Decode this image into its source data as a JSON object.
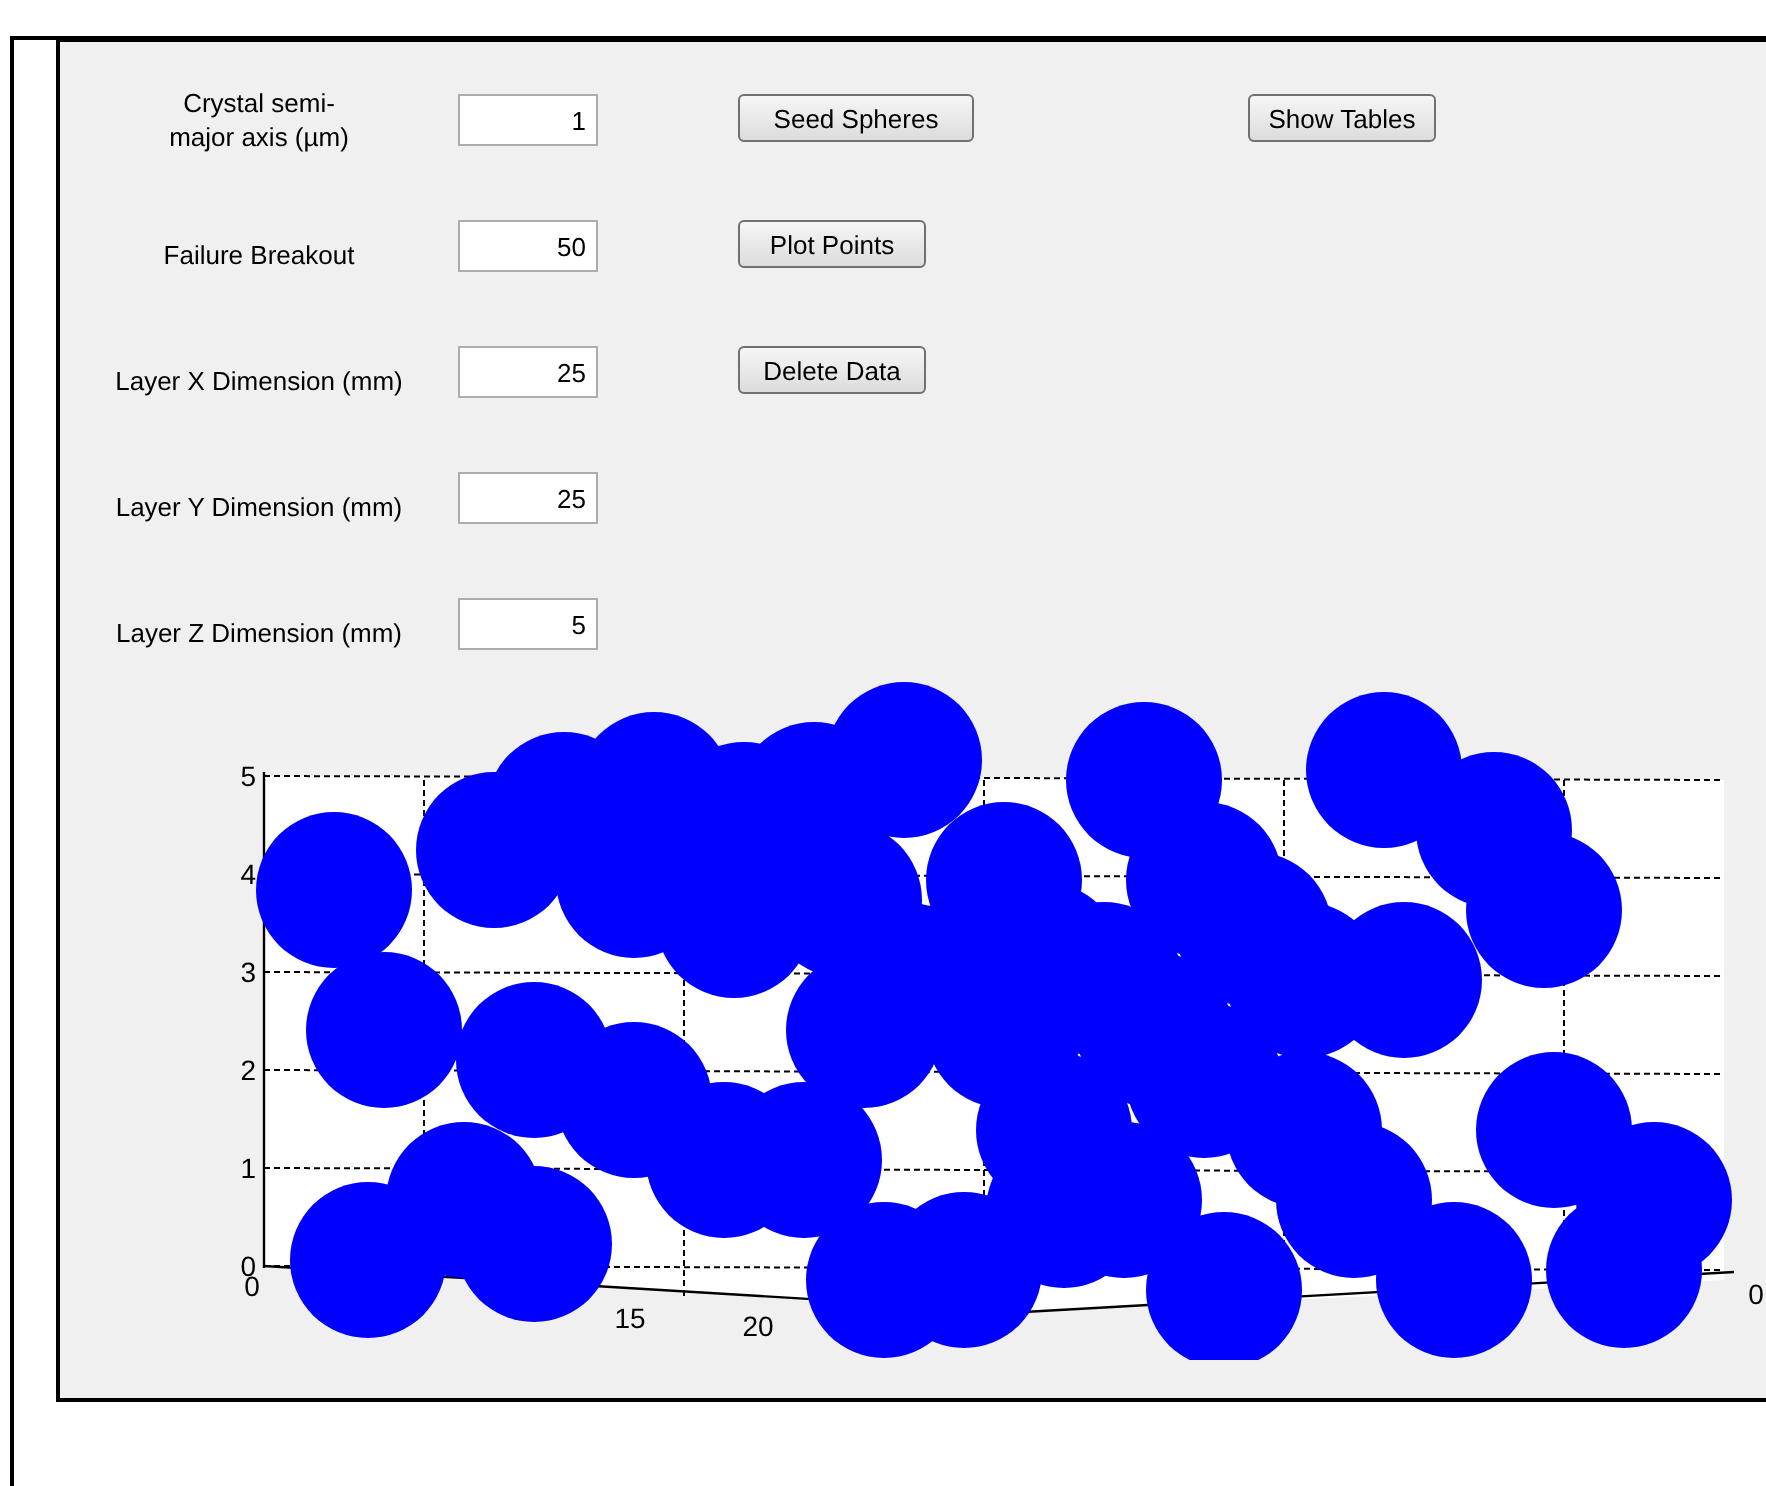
{
  "fields": [
    {
      "label": "Crystal semi-\nmajor axis (µm)",
      "value": "1"
    },
    {
      "label": "Failure Breakout",
      "value": "50"
    },
    {
      "label": "Layer X Dimension (mm)",
      "value": "25"
    },
    {
      "label": "Layer Y Dimension (mm)",
      "value": "25"
    },
    {
      "label": "Layer Z Dimension (mm)",
      "value": "5"
    }
  ],
  "action_buttons": [
    "Seed Spheres",
    "Plot Points",
    "Delete Data"
  ],
  "side_buttons": [
    "Show Tables"
  ],
  "plot": {
    "z_ticks": [
      "5",
      "4",
      "3",
      "2",
      "1",
      "0"
    ],
    "bottom_ticks": [
      "0",
      "15",
      "20",
      "0"
    ]
  }
}
